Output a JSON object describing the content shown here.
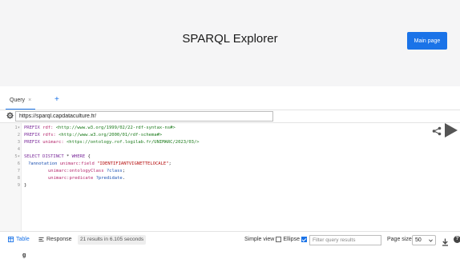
{
  "header": {
    "title": "SPARQL Explorer",
    "main_page_label": "Main page",
    "accent_color": "#1a73e8"
  },
  "tabs": {
    "query_label": "Query",
    "close_glyph": "×",
    "add_glyph": "+"
  },
  "endpoint": {
    "value": "https://sparql.capdataculture.fr/"
  },
  "editor": {
    "line_numbers": [
      "1",
      "2",
      "3",
      "4",
      "5",
      "6",
      "7",
      "8",
      "9"
    ],
    "fold_markers": [
      "▾",
      "",
      "",
      "",
      "▾",
      "",
      "",
      "",
      ""
    ],
    "line1": {
      "kw": "PREFIX",
      "pfx": "rdf:",
      "iri": "<http://www.w3.org/1999/02/22-rdf-syntax-ns#>"
    },
    "line2": {
      "kw": "PREFIX",
      "pfx": "rdfs:",
      "iri": "<http://www.w3.org/2000/01/rdf-schema#>"
    },
    "line3": {
      "kw": "PREFIX",
      "pfx": "unimarc:",
      "iri": "<https://ontology.rof.logilab.fr/UNIMARC/2023/03/>"
    },
    "line5": {
      "kw": "SELECT DISTINCT",
      "rest": "* ",
      "kw2": "WHERE",
      "brace": "{"
    },
    "line6": {
      "var": "?annotation",
      "pfx": "unimarc:field",
      "str": "\"IDENTIFIANTVIGNETTELOCALE\"",
      "end": ";"
    },
    "line7": {
      "pfx": "unimarc:ontologyClass",
      "var": "?class",
      "end": ";"
    },
    "line8": {
      "pfx": "unimarc:predicate",
      "var": "?predidate",
      "end": "."
    },
    "line9": {
      "brace": "}"
    }
  },
  "icons": {
    "share": "share-icon",
    "run": "run-query-icon",
    "gear": "gear-icon",
    "table": "table-icon",
    "response": "response-icon",
    "download": "download-icon",
    "help": "help-icon"
  },
  "results": {
    "table_label": "Table",
    "response_label": "Response",
    "count_text": "21 results in 6.105 seconds",
    "simple_view_label": "Simple view",
    "simple_view_checked": false,
    "ellipse_label": "Ellipse",
    "ellipse_checked": true,
    "filter_placeholder": "Filter query results",
    "page_size_label": "Page size:",
    "page_size_value": "50",
    "column_header": "g"
  }
}
